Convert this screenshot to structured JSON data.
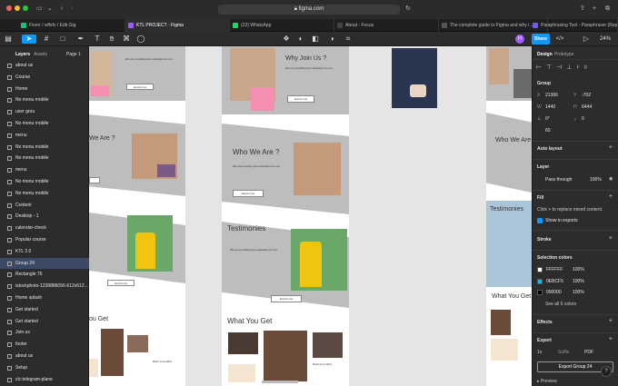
{
  "browser": {
    "url": "figma.com",
    "tabs": [
      {
        "label": "Fiverr / wlfsfx / Edit Gig",
        "color": "#1dbf73"
      },
      {
        "label": "KTL PROJECT - Figma",
        "color": "#a259ff",
        "active": true
      },
      {
        "label": "(23) WhatsApp",
        "color": "#25d366"
      },
      {
        "label": "About - Focus",
        "color": "#444444"
      },
      {
        "label": "The complete guide to Figma and why i...",
        "color": "#555555"
      },
      {
        "label": "Paraphrasing Tool - Paraphraser (Rephr...",
        "color": "#6c5ce7"
      }
    ]
  },
  "toolbar": {
    "zoom": "24%",
    "share_label": "Share",
    "avatar_initial": "H"
  },
  "left_panel": {
    "tabs": {
      "layers": "Layers",
      "assets": "Assets",
      "page": "Page 1"
    },
    "layers": [
      "about us",
      "Course",
      "Home",
      "No menu mobile",
      "user grou",
      "No menu mobile",
      "menu",
      "No menu mobile",
      "No menu mobile",
      "menu",
      "No menu mobile",
      "No menu mobile",
      "Content",
      "Desktop - 1",
      "calendar-check",
      "Popular course",
      "KTL 2.0",
      "Group 24",
      "Rectangle 76",
      "istockphoto-1228886056-612x612...",
      "Home splash",
      "Get started",
      "Get started",
      "Join us",
      "footer",
      "about us",
      "Setup",
      "clc:telegram-plane"
    ],
    "selected_index": 17
  },
  "canvas": {
    "why_join": "Why Join Us ?",
    "who_we_are": "Who We Are ?",
    "who_we_are_partial": "We Are ?",
    "testimonies": "Testimonies",
    "what_you_get": "What You Get",
    "what_you_get_partial": "ou Get",
    "enroll_label": "Enroll now",
    "read_more": "Read more",
    "lorem_short": "We are providing free education for our",
    "lorem_line": "English Toefl test ...",
    "card_caption": "Build Your Mind",
    "card_caption2": "Creative Mind"
  },
  "right_panel": {
    "tabs": {
      "design": "Design",
      "prototype": "Prototype"
    },
    "group_label": "Group",
    "x_label": "X",
    "x_value": "21366",
    "y_label": "Y",
    "y_value": "-702",
    "w_label": "W",
    "w_value": "1440",
    "h_label": "H",
    "h_value": "6444",
    "rotation": "0°",
    "corner": "0",
    "clip": "0",
    "radius": "60",
    "auto_layout": "Auto layout",
    "layer_label": "Layer",
    "blend_mode": "Pass through",
    "opacity": "100%",
    "fill_label": "Fill",
    "fill_hint": "Click + to replace mixed content.",
    "show_exports": "Show in exports",
    "stroke_label": "Stroke",
    "selection_colors": "Selection colors",
    "colors": [
      {
        "hex": "FFFFFF",
        "opacity": "100%",
        "swatch": "#FFFFFF"
      },
      {
        "hex": "0EBCF5",
        "opacity": "100%",
        "swatch": "#0EBCF5"
      },
      {
        "hex": "000000",
        "opacity": "100%",
        "swatch": "#000000"
      }
    ],
    "see_all": "See all 6 colors",
    "effects_label": "Effects",
    "export_label": "Export",
    "export_scale": "1x",
    "export_suffix": "Suffix",
    "export_format": "PDF",
    "export_button": "Export Group 24",
    "preview_label": "Preview"
  },
  "colors": {
    "accent": "#0d99ff",
    "panel": "#2c2c2c",
    "canvas": "#e5e5e5",
    "pink": "#f48fb1",
    "selected": "#3d4a66"
  }
}
